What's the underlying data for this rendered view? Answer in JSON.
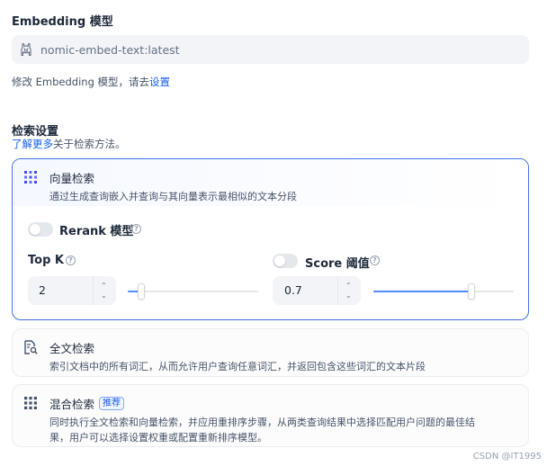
{
  "embedding": {
    "section_title": "Embedding 模型",
    "model_value": "nomic-embed-text:latest",
    "hint_prefix": "修改 Embedding 模型，请去",
    "hint_link": "设置"
  },
  "retrieval": {
    "section_title": "检索设置",
    "learn_more_link": "了解更多",
    "learn_more_suffix": "关于检索方法。",
    "methods": {
      "vector": {
        "title": "向量检索",
        "description": "通过生成查询嵌入并查询与其向量表示最相似的文本分段",
        "icon": "grid-dots-icon",
        "selected": true
      },
      "fulltext": {
        "title": "全文检索",
        "description": "索引文档中的所有词汇，从而允许用户查询任意词汇，并返回包含这些词汇的文本片段",
        "icon": "document-search-icon"
      },
      "hybrid": {
        "title": "混合检索",
        "badge": "推荐",
        "description_line1": "同时执行全文检索和向量检索，并应用重排序步骤，从两类查询结果中选择匹配用户问题的最佳结",
        "description_line2": "果，用户可以选择设置权重或配置重新排序模型。",
        "icon": "grid-icon"
      }
    },
    "rerank": {
      "label": "Rerank 模型",
      "enabled": false
    },
    "top_k": {
      "label": "Top K",
      "value": "2",
      "slider_fraction": 0.1
    },
    "score_threshold": {
      "label": "Score 阈值",
      "value": "0.7",
      "enabled": false,
      "slider_fraction": 0.7
    }
  },
  "watermark": "CSDN @IT1995",
  "colors": {
    "accent": "#155eef",
    "active_border": "#3f72e8",
    "slider_fill": "#528bff"
  }
}
